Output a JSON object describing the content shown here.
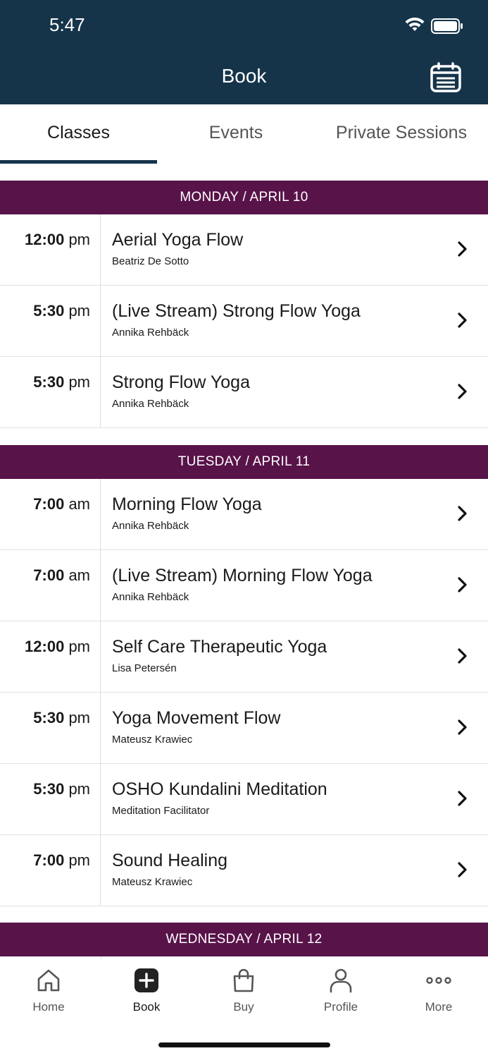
{
  "status_bar": {
    "time": "5:47"
  },
  "header": {
    "title": "Book",
    "calendar_icon": "calendar-icon"
  },
  "tabs": [
    {
      "label": "Classes",
      "active": true
    },
    {
      "label": "Events",
      "active": false
    },
    {
      "label": "Private Sessions",
      "active": false
    }
  ],
  "days": [
    {
      "header": "MONDAY / APRIL 10",
      "classes": [
        {
          "time": "12:00",
          "ampm": "pm",
          "name": "Aerial Yoga Flow",
          "instructor": "Beatriz De Sotto"
        },
        {
          "time": "5:30",
          "ampm": "pm",
          "name": "(Live Stream) Strong Flow Yoga",
          "instructor": "Annika Rehbäck"
        },
        {
          "time": "5:30",
          "ampm": "pm",
          "name": "Strong Flow Yoga",
          "instructor": "Annika Rehbäck"
        }
      ]
    },
    {
      "header": "TUESDAY / APRIL 11",
      "classes": [
        {
          "time": "7:00",
          "ampm": "am",
          "name": "Morning Flow Yoga",
          "instructor": "Annika Rehbäck"
        },
        {
          "time": "7:00",
          "ampm": "am",
          "name": "(Live Stream) Morning Flow Yoga",
          "instructor": "Annika Rehbäck"
        },
        {
          "time": "12:00",
          "ampm": "pm",
          "name": "Self Care Therapeutic Yoga",
          "instructor": "Lisa Petersén"
        },
        {
          "time": "5:30",
          "ampm": "pm",
          "name": "Yoga Movement Flow",
          "instructor": "Mateusz Krawiec"
        },
        {
          "time": "5:30",
          "ampm": "pm",
          "name": "OSHO Kundalini Meditation",
          "instructor": "Meditation Facilitator"
        },
        {
          "time": "7:00",
          "ampm": "pm",
          "name": "Sound Healing",
          "instructor": "Mateusz Krawiec"
        }
      ]
    },
    {
      "header": "WEDNESDAY / APRIL 12",
      "classes": []
    }
  ],
  "bottom_nav": [
    {
      "label": "Home",
      "icon": "home-icon",
      "active": false
    },
    {
      "label": "Book",
      "icon": "plus-square-icon",
      "active": true
    },
    {
      "label": "Buy",
      "icon": "shopping-bag-icon",
      "active": false
    },
    {
      "label": "Profile",
      "icon": "person-icon",
      "active": false
    },
    {
      "label": "More",
      "icon": "more-dots-icon",
      "active": false
    }
  ],
  "colors": {
    "header_bg": "#15344a",
    "day_header_bg": "#581349"
  }
}
